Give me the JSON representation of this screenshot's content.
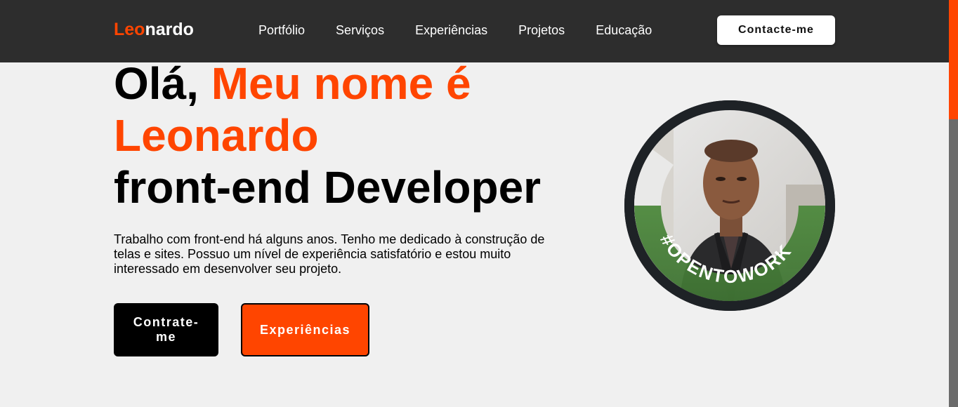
{
  "header": {
    "logo_accent": "Leo",
    "logo_rest": "nardo",
    "nav": [
      "Portfólio",
      "Serviços",
      "Experiências",
      "Projetos",
      "Educação"
    ],
    "contact_label": "Contacte-me"
  },
  "hero": {
    "greeting": "Olá, ",
    "name_prefix": "Meu nome é",
    "name": "Leonardo",
    "role": "front-end Developer",
    "description": "Trabalho com front-end há alguns anos. Tenho me dedicado à construção de telas e sites. Possuo um nível de experiência satisfatório e estou muito interessado em desenvolver seu projeto.",
    "hire_label": "Contrate-me",
    "experience_label": "Experiências"
  },
  "avatar": {
    "badge_text": "#OPENTOWORK",
    "badge_color": "#4a7a3a"
  },
  "colors": {
    "accent": "#ff4500",
    "header_bg": "#2d2d2d",
    "page_bg": "#f0f0f0"
  }
}
